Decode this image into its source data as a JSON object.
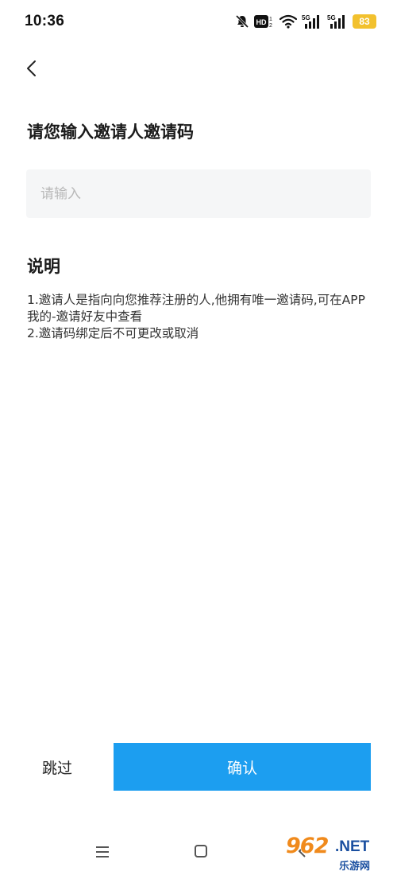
{
  "status_bar": {
    "time": "10:36",
    "battery": "83",
    "icons": [
      "bell-off-icon",
      "hd-icon",
      "wifi-icon",
      "signal-5g-1-icon",
      "signal-5g-2-icon",
      "battery-icon"
    ],
    "network_label_1": "5G",
    "network_label_2": "5G",
    "hd_label": "HD"
  },
  "header": {
    "back_icon": "chevron-left-icon"
  },
  "main": {
    "title": "请您输入邀请人邀请码",
    "input_placeholder": "请输入",
    "input_value": "",
    "section_heading": "说明",
    "description_lines": [
      "1.邀请人是指向向您推荐注册的人,他拥有唯一邀请码,可在APP我的-邀请好友中查看",
      "2.邀请码绑定后不可更改或取消"
    ]
  },
  "actions": {
    "skip_label": "跳过",
    "confirm_label": "确认"
  },
  "nav_bar": {
    "icons": [
      "menu-icon",
      "home-icon",
      "back-icon"
    ]
  },
  "watermark": {
    "logo_text": "962",
    "suffix_text": ".NET",
    "site_name": "乐游网"
  },
  "colors": {
    "primary": "#1c9ef0",
    "input_bg": "#f5f6f7",
    "battery": "#f2c12e",
    "watermark_orange": "#f08a1c",
    "watermark_blue": "#1a4fa0"
  }
}
